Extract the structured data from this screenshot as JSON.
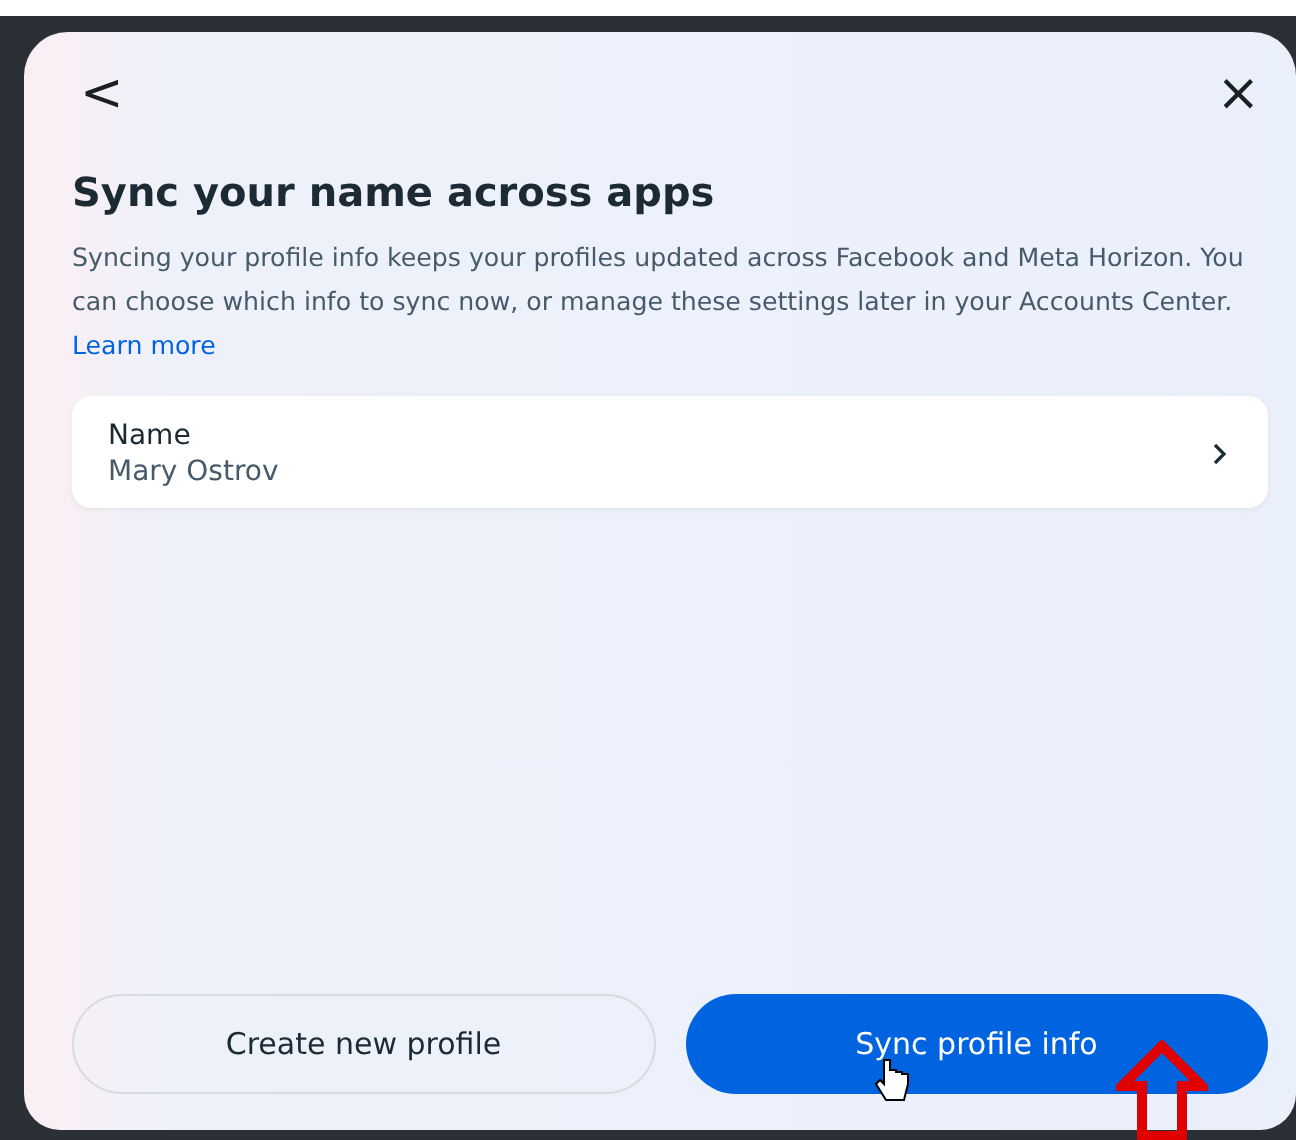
{
  "dialog": {
    "back": "<",
    "close": "×",
    "title": "Sync your name across apps",
    "description": "Syncing your profile info keeps your profiles updated across Facebook and Meta Horizon. You can choose which info to sync now, or manage these settings later in your Accounts Center.",
    "link": "Learn more"
  },
  "fields": [
    {
      "label": "Name",
      "value": "Mary Ostrov"
    }
  ],
  "buttons": [
    {
      "label": "Create new profile",
      "kind": "secondary"
    },
    {
      "label": "Sync profile info",
      "kind": "primary"
    }
  ]
}
